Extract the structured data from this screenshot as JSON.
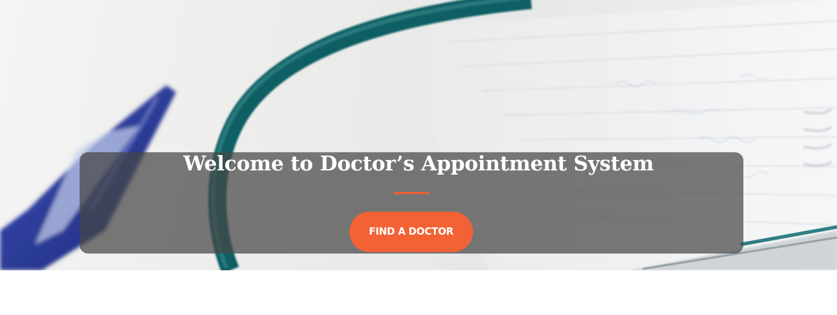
{
  "hero": {
    "title": "Welcome to Doctor’s Appointment System",
    "cta_label": "FIND A DOCTOR",
    "background_image": "stethoscope-notebook-pen-photo"
  },
  "colors": {
    "accent": "#f26235",
    "overlay": "rgba(70,70,70,0.72)",
    "title_text": "#ffffff"
  }
}
